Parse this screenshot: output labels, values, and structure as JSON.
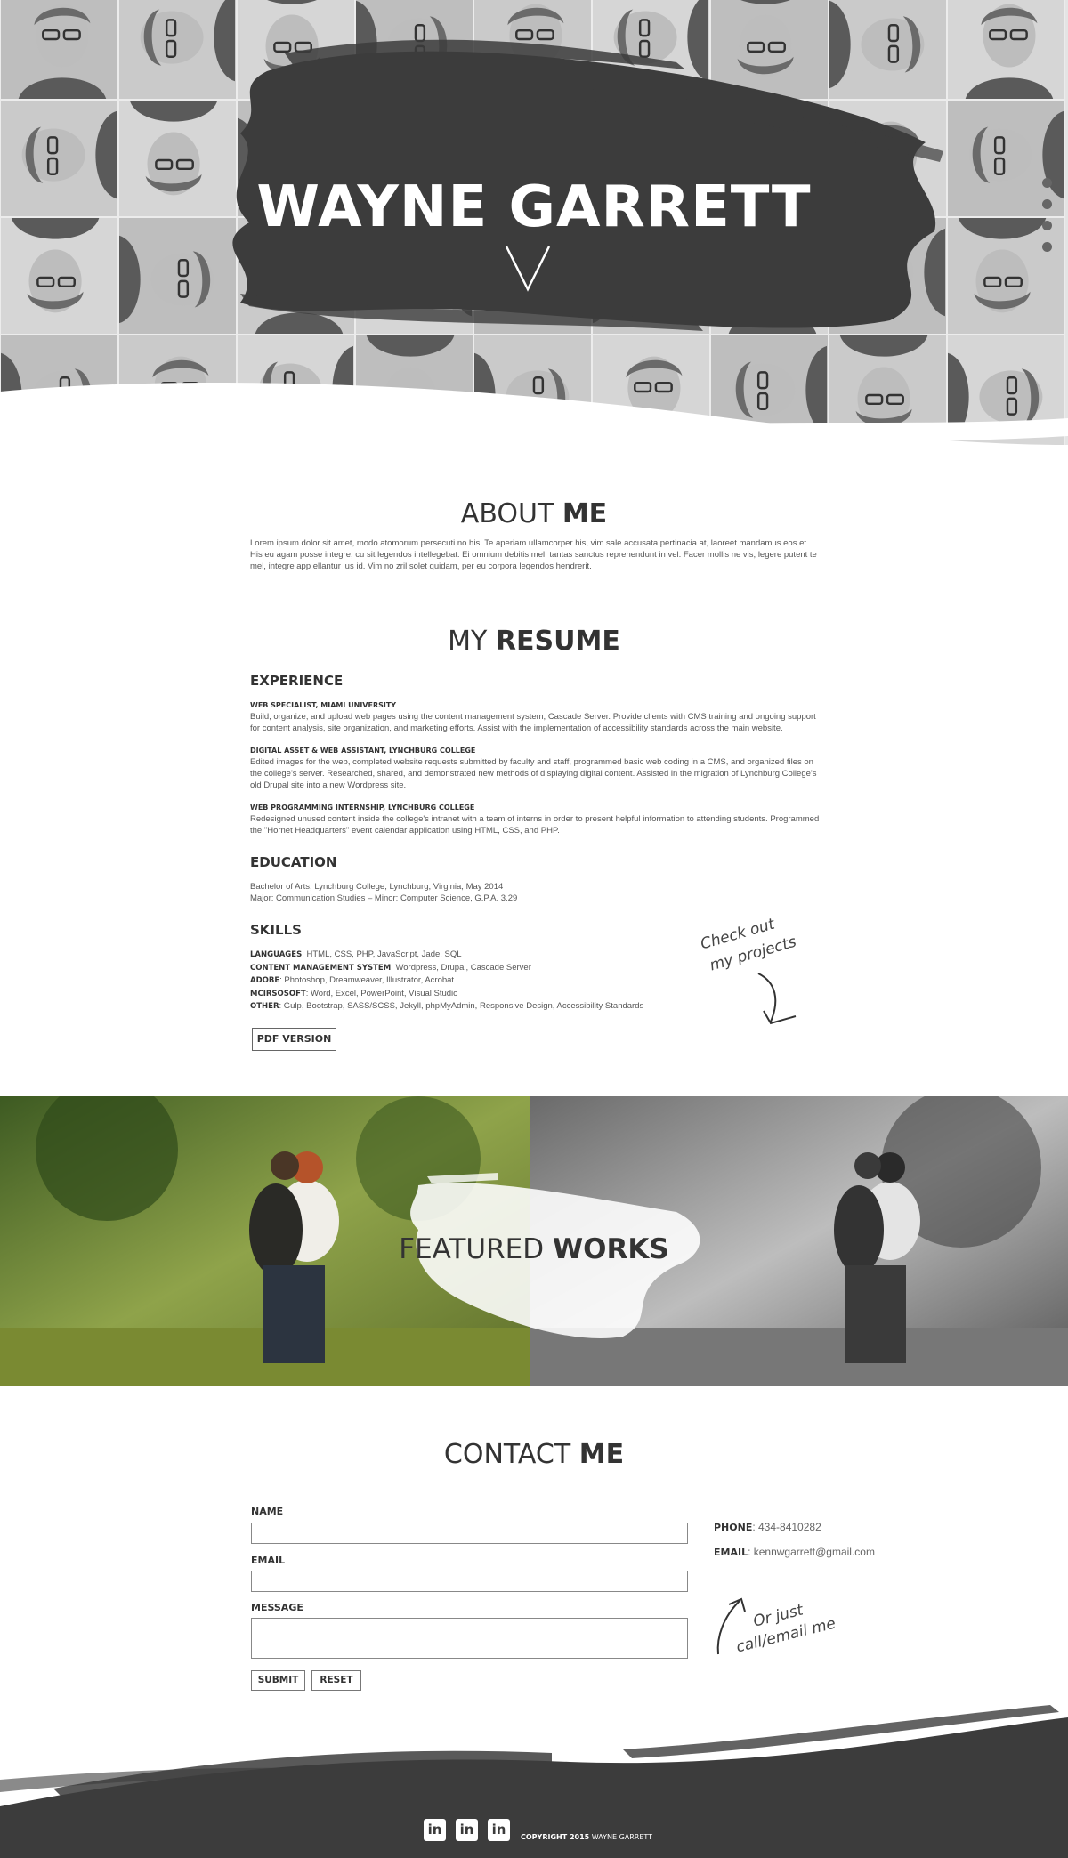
{
  "hero": {
    "name": "WAYNE GARRETT",
    "nav_dot_count": 4
  },
  "about": {
    "title_light": "ABOUT",
    "title_bold": "ME",
    "text": "Lorem ipsum dolor sit amet, modo atomorum persecuti no his. Te aperiam ullamcorper his, vim sale accusata pertinacia at, laoreet mandamus eos et. His eu agam posse integre, cu sit legendos intellegebat. Ei omnium debitis mel, tantas sanctus reprehendunt in vel. Facer mollis ne vis, legere putent te mel, integre app ellantur ius id. Vim no zril solet quidam, per eu corpora legendos hendrerit."
  },
  "resume": {
    "title_light": "MY",
    "title_bold": "RESUME",
    "experience_heading": "EXPERIENCE",
    "jobs": [
      {
        "title": "WEB SPECIALIST, MIAMI UNIVERSITY",
        "desc": "Build, organize, and upload web pages using the content management system, Cascade Server. Provide clients with CMS training and ongoing support for content analysis, site organization, and marketing efforts. Assist with the implementation of accessibility standards across the main website."
      },
      {
        "title": "DIGITAL ASSET & WEB ASSISTANT, LYNCHBURG COLLEGE",
        "desc": "Edited images for the web, completed website requests submitted by faculty and staff, programmed basic web coding in a CMS, and organized files on the college's server. Researched, shared, and demonstrated new methods of displaying digital content. Assisted in the migration of Lynchburg College's old Drupal site into a new Wordpress site."
      },
      {
        "title": "WEB PROGRAMMING INTERNSHIP, LYNCHBURG COLLEGE",
        "desc": "Redesigned unused content inside the college's intranet with a team of interns in order to present helpful information to attending students. Programmed the \"Hornet Headquarters\" event calendar application using HTML, CSS, and PHP."
      }
    ],
    "education_heading": "EDUCATION",
    "education_lines": [
      "Bachelor of Arts, Lynchburg College, Lynchburg, Virginia, May 2014",
      "Major: Communication Studies – Minor: Computer Science, G.P.A. 3.29"
    ],
    "skills_heading": "SKILLS",
    "skills": [
      {
        "label": "LANGUAGES",
        "value": ": HTML, CSS, PHP, JavaScript, Jade, SQL"
      },
      {
        "label": "CONTENT MANAGEMENT SYSTEM",
        "value": ": Wordpress, Drupal, Cascade Server"
      },
      {
        "label": "ADOBE",
        "value": ": Photoshop, Dreamweaver, Illustrator, Acrobat"
      },
      {
        "label": "MCIRSOSOFT",
        "value": ": Word, Excel, PowerPoint, Visual Studio"
      },
      {
        "label": "OTHER",
        "value": ": Gulp, Bootstrap, SASS/SCSS, Jekyll, phpMyAdmin, Responsive Design, Accessibility Standards"
      }
    ],
    "pdf_button": "PDF VERSION",
    "projects_note_line1": "Check out",
    "projects_note_line2": "my projects"
  },
  "featured": {
    "title_light": "FEATURED",
    "title_bold": "WORKS"
  },
  "contact": {
    "title_light": "CONTACT",
    "title_bold": "ME",
    "name_label": "NAME",
    "email_label": "EMAIL",
    "message_label": "MESSAGE",
    "submit_button": "SUBMIT",
    "reset_button": "RESET",
    "phone_label": "PHONE",
    "phone_value": ": 434-8410282",
    "email_info_label": "EMAIL",
    "email_info_value": ": kennwgarrett@gmail.com",
    "note_line1": "Or just",
    "note_line2": "call/email me"
  },
  "footer": {
    "social_icons": [
      "linkedin-icon",
      "linkedin-icon",
      "linkedin-icon"
    ],
    "icon_glyph": "in",
    "copyright_bold": "COPYRIGHT 2015",
    "copyright_name": " WAYNE GARRETT"
  },
  "colors": {
    "accent": "#3a3a3a",
    "text": "#333333",
    "muted": "#555555",
    "background": "#ffffff"
  }
}
